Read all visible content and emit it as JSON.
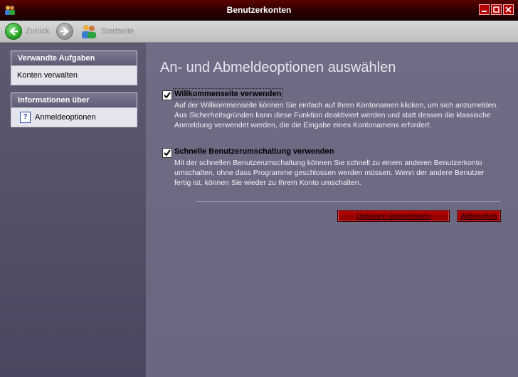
{
  "window": {
    "title": "Benutzerkonten"
  },
  "toolbar": {
    "back_label": "Zurück",
    "home_label": "Startseite"
  },
  "sidebar": {
    "related_tasks": {
      "title": "Verwandte Aufgaben",
      "items": [
        "Konten verwalten"
      ]
    },
    "info": {
      "title": "Informationen über",
      "items": [
        "Anmeldeoptionen"
      ]
    }
  },
  "main": {
    "heading": "An- und Abmeldeoptionen auswählen",
    "options": [
      {
        "title": "Willkommenseite verwenden",
        "checked": true,
        "description": "Auf der Willkommenseite können Sie einfach auf Ihren Kontonamen klicken, um sich anzumelden. Aus Sicherheitsgründen kann diese Funktion deaktiviert werden und statt dessen die klassische Anmeldung verwendet werden, die die Eingabe eines Kontonamens erfordert."
      },
      {
        "title": "Schnelle Benutzerumschaltung verwenden",
        "checked": true,
        "description": "Mit der schnellen Benutzerumschaltung können Sie schnell zu einem anderen Benutzerkonto umschalten, ohne dass Programme geschlossen werden müssen. Wenn der andere Benutzer fertig ist, können Sie wieder zu Ihrem Konto umschalten."
      }
    ],
    "apply_label": "Optionen übernehmen",
    "cancel_label": "Abbrechen"
  },
  "colors": {
    "titlebar": "#3a0000",
    "accent_button": "#a00000",
    "panel_bg": "#e4e4ec",
    "main_bg": "#6f6c86"
  }
}
